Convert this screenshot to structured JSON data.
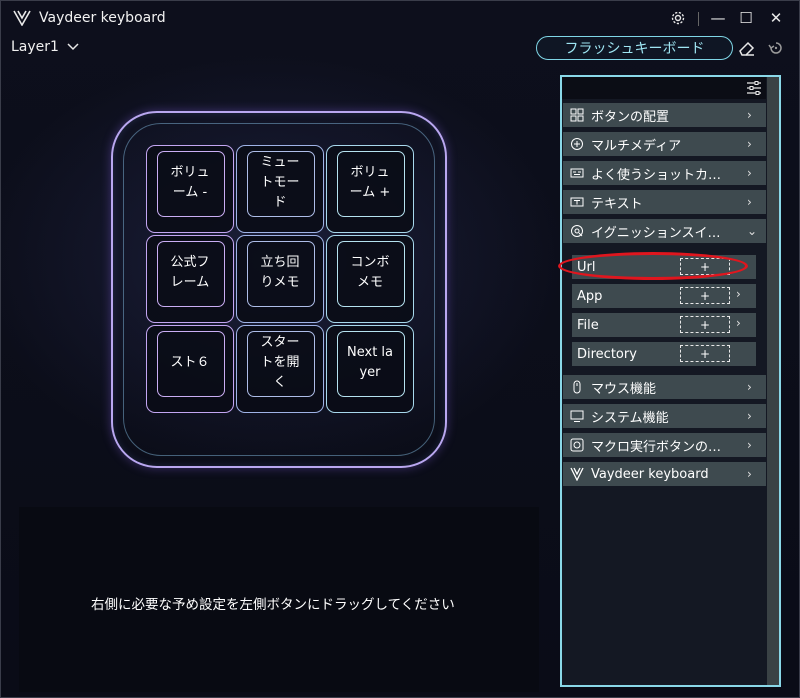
{
  "window": {
    "title": "Vaydeer keyboard",
    "controls": {
      "minimize": "—",
      "maximize": "☐",
      "close": "✕"
    }
  },
  "toolbar": {
    "layer_label": "Layer1",
    "flash_label": "フラッシュキーボード"
  },
  "keys": [
    {
      "label": "ボリュ\nーム -"
    },
    {
      "label": "ミュー\nトモー\nド"
    },
    {
      "label": "ボリュ\nーム +"
    },
    {
      "label": "公式フ\nレーム"
    },
    {
      "label": "立ち回\nりメモ"
    },
    {
      "label": "コンボ\nメモ"
    },
    {
      "label": "スト６"
    },
    {
      "label": "スター\nトを開\nく"
    },
    {
      "label": "Next la\nyer"
    }
  ],
  "hint": "右側に必要な予め設定を左側ボタンにドラッグしてください",
  "panel": {
    "categories_top": [
      {
        "label": "ボタンの配置",
        "icon": "grid-icon",
        "chevron": "›"
      },
      {
        "label": "マルチメディア",
        "icon": "media-icon",
        "chevron": "›"
      },
      {
        "label": "よく使うショットカ…",
        "icon": "shortcut-icon",
        "chevron": "›"
      },
      {
        "label": "テキスト",
        "icon": "text-icon",
        "chevron": "›"
      },
      {
        "label": "イグニッションスイ…",
        "icon": "ignition-icon",
        "chevron": "⌄"
      }
    ],
    "sub_items": [
      {
        "label": "Url",
        "plus": "+"
      },
      {
        "label": "App",
        "plus": "+",
        "chevron": "›"
      },
      {
        "label": "File",
        "plus": "+",
        "chevron": "›"
      },
      {
        "label": "Directory",
        "plus": "+"
      }
    ],
    "categories_bottom": [
      {
        "label": "マウス機能",
        "icon": "mouse-icon",
        "chevron": "›"
      },
      {
        "label": "システム機能",
        "icon": "monitor-icon",
        "chevron": "›"
      },
      {
        "label": "マクロ実行ボタンの…",
        "icon": "macro-icon",
        "chevron": "›"
      },
      {
        "label": "Vaydeer keyboard",
        "icon": "vaydeer-logo-icon",
        "chevron": "›"
      }
    ]
  },
  "colors": {
    "accent": "#7fd6e6",
    "panel_item": "#3e4a4f",
    "highlight_oval": "#e0161e"
  }
}
